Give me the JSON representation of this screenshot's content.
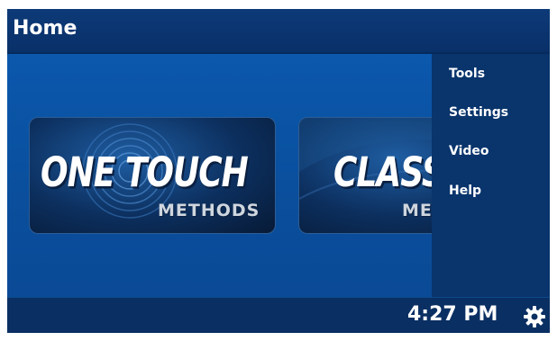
{
  "header": {
    "title": "Home"
  },
  "tiles": [
    {
      "title": "ONE TOUCH",
      "subtitle": "METHODS"
    },
    {
      "title": "CLASSIC",
      "subtitle": "METHODS"
    }
  ],
  "menu": {
    "items": [
      {
        "label": "Tools"
      },
      {
        "label": "Settings"
      },
      {
        "label": "Video"
      },
      {
        "label": "Help"
      }
    ]
  },
  "footer": {
    "time": "4:27 PM",
    "settings_icon": "gear-icon"
  },
  "colors": {
    "background": "#0a4d9a",
    "header": "#0a3068",
    "menu": "#09346c",
    "footer": "#0a2f63",
    "text": "#ffffff"
  }
}
